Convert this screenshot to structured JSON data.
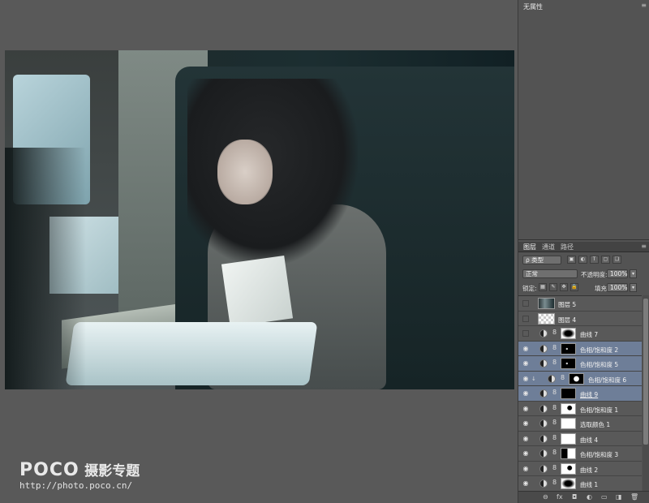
{
  "properties": {
    "title": "无属性",
    "menu": "≡"
  },
  "layers_panel": {
    "tabs": [
      "图层",
      "通道",
      "路径"
    ],
    "menu": "≡",
    "filter_kind": "ρ 类型",
    "filter_icons": [
      "▣",
      "◐",
      "T",
      "▢",
      "❏"
    ],
    "blend_mode": "正常",
    "opacity_label": "不透明度:",
    "opacity_value": "100%",
    "lock_label": "锁定:",
    "lock_icons": [
      "▦",
      "✎",
      "✥",
      "🔒"
    ],
    "fill_label": "填充:",
    "fill_value": "100%",
    "dropdown_arrow": "▾",
    "eye": "◉",
    "chain": "8",
    "clip": "↓",
    "layers": [
      {
        "name": "图层 5"
      },
      {
        "name": "图层 4"
      },
      {
        "name": "曲线 7"
      },
      {
        "name": "色相/饱和度 2"
      },
      {
        "name": "色相/饱和度 5"
      },
      {
        "name": "色相/饱和度 6"
      },
      {
        "name": "曲线 9"
      },
      {
        "name": "色相/饱和度 1"
      },
      {
        "name": "选取颜色 1"
      },
      {
        "name": "曲线 4"
      },
      {
        "name": "色相/饱和度 3"
      },
      {
        "name": "曲线 2"
      },
      {
        "name": "曲线 1"
      }
    ],
    "bottom_icons": [
      "⊖",
      "fx",
      "◘",
      "◐",
      "▭",
      "◨",
      "🗑"
    ]
  },
  "watermark": {
    "logo": "POCO",
    "title": "摄影专题",
    "url": "http://photo.poco.cn/"
  }
}
